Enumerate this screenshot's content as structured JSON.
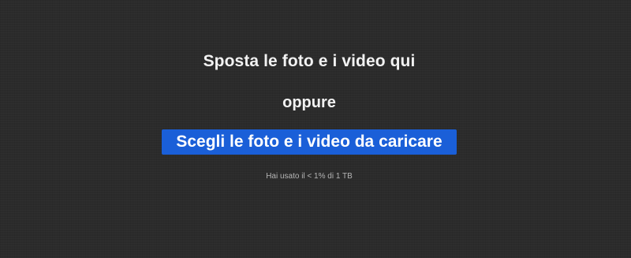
{
  "upload": {
    "drop_prompt": "Sposta le foto e i video qui",
    "or_label": "oppure",
    "choose_button_label": "Scegli le foto e i video da caricare",
    "quota_text": "Hai usato il < 1% di 1 TB"
  },
  "colors": {
    "background": "#2b2b2b",
    "button": "#1a5fd8",
    "text": "#f2f2f2",
    "muted_text": "#b5b5b5"
  }
}
